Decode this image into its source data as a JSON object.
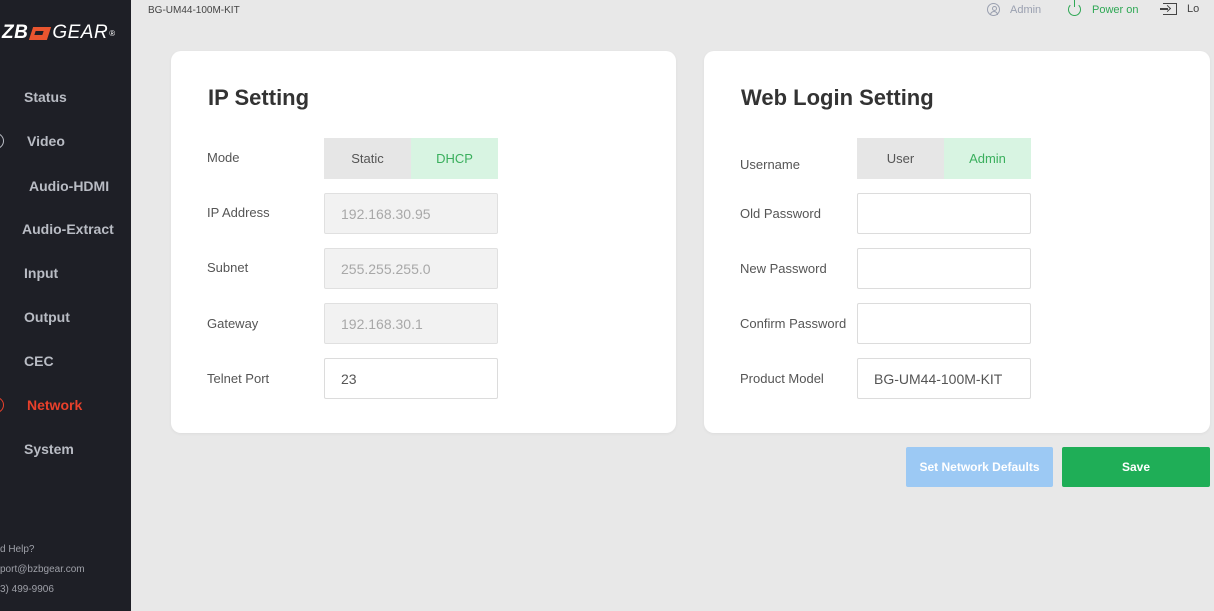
{
  "brand": {
    "logo_left": "ZB",
    "logo_right": "GEAR",
    "logo_reg": "®"
  },
  "header": {
    "device": "BG-UM44-100M-KIT",
    "user": "Admin",
    "power": "Power on",
    "logout": "Lo"
  },
  "sidebar": {
    "items": [
      {
        "label": "Status"
      },
      {
        "label": "Video"
      },
      {
        "label": "Audio-HDMI"
      },
      {
        "label": "Audio-Extract"
      },
      {
        "label": "Input"
      },
      {
        "label": "Output"
      },
      {
        "label": "CEC"
      },
      {
        "label": "Network"
      },
      {
        "label": "System"
      }
    ],
    "help": [
      "d Help?",
      "port@bzbgear.com",
      "3) 499-9906"
    ]
  },
  "ip": {
    "title": "IP Setting",
    "mode_label": "Mode",
    "mode_options": [
      "Static",
      "DHCP"
    ],
    "ip_label": "IP Address",
    "ip_value": "192.168.30.95",
    "subnet_label": "Subnet",
    "subnet_value": "255.255.255.0",
    "gateway_label": "Gateway",
    "gateway_value": "192.168.30.1",
    "telnet_label": "Telnet Port",
    "telnet_value": "23"
  },
  "web": {
    "title": "Web Login Setting",
    "username_label": "Username",
    "username_options": [
      "User",
      "Admin"
    ],
    "old_label": "Old Password",
    "new_label": "New Password",
    "confirm_label": "Confirm Password",
    "model_label": "Product Model",
    "model_value": "BG-UM44-100M-KIT"
  },
  "actions": {
    "defaults": "Set Network Defaults",
    "save": "Save"
  },
  "colors": {
    "accent_active": "#e9402b",
    "green": "#1fae57",
    "blue_light": "#9cc9f4",
    "sidebar": "#1e1f26"
  }
}
